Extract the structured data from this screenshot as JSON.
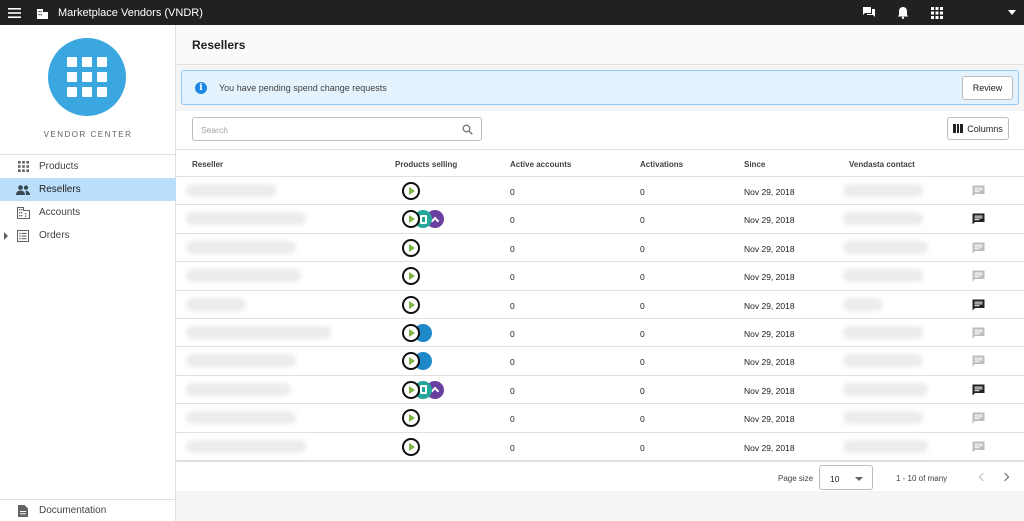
{
  "app": {
    "title": "Marketplace Vendors (VNDR)"
  },
  "sidebar": {
    "brand": "VENDOR CENTER",
    "items": [
      {
        "label": "Products",
        "icon": "grid-icon"
      },
      {
        "label": "Resellers",
        "icon": "people-icon",
        "active": true
      },
      {
        "label": "Accounts",
        "icon": "building-icon"
      },
      {
        "label": "Orders",
        "icon": "list-icon",
        "expandable": true
      }
    ],
    "footer": {
      "label": "Documentation",
      "icon": "document-icon"
    }
  },
  "page": {
    "title": "Resellers"
  },
  "banner": {
    "icon": "info-icon",
    "text": "You have pending spend change requests",
    "action_label": "Review"
  },
  "toolbar": {
    "search_placeholder": "Search",
    "columns_label": "Columns"
  },
  "table": {
    "headers": {
      "reseller": "Reseller",
      "products": "Products selling",
      "active_accounts": "Active accounts",
      "activations": "Activations",
      "since": "Since",
      "contact": "Vendasta contact"
    },
    "rows": [
      {
        "products": [
          "play"
        ],
        "active_accounts": "0",
        "activations": "0",
        "since": "Nov 29, 2018",
        "message_state": "inactive"
      },
      {
        "products": [
          "play",
          "teal",
          "purple"
        ],
        "active_accounts": "0",
        "activations": "0",
        "since": "Nov 29, 2018",
        "message_state": "active"
      },
      {
        "products": [
          "play"
        ],
        "active_accounts": "0",
        "activations": "0",
        "since": "Nov 29, 2018",
        "message_state": "inactive"
      },
      {
        "products": [
          "play"
        ],
        "active_accounts": "0",
        "activations": "0",
        "since": "Nov 29, 2018",
        "message_state": "inactive"
      },
      {
        "products": [
          "play"
        ],
        "active_accounts": "0",
        "activations": "0",
        "since": "Nov 29, 2018",
        "message_state": "active"
      },
      {
        "products": [
          "play",
          "blue"
        ],
        "active_accounts": "0",
        "activations": "0",
        "since": "Nov 29, 2018",
        "message_state": "inactive"
      },
      {
        "products": [
          "play",
          "blue"
        ],
        "active_accounts": "0",
        "activations": "0",
        "since": "Nov 29, 2018",
        "message_state": "inactive"
      },
      {
        "products": [
          "play",
          "teal",
          "purple"
        ],
        "active_accounts": "0",
        "activations": "0",
        "since": "Nov 29, 2018",
        "message_state": "active"
      },
      {
        "products": [
          "play"
        ],
        "active_accounts": "0",
        "activations": "0",
        "since": "Nov 29, 2018",
        "message_state": "inactive"
      },
      {
        "products": [
          "play"
        ],
        "active_accounts": "0",
        "activations": "0",
        "since": "Nov 29, 2018",
        "message_state": "inactive"
      }
    ]
  },
  "pager": {
    "size_label": "Page size",
    "size_value": "10",
    "range": "1 - 10 of many"
  },
  "colors": {
    "topbar": "#212121",
    "accent": "#3aa7e0",
    "active_nav": "#bbdefb",
    "banner_bg": "#e3f2fd",
    "info": "#1e88e5"
  }
}
